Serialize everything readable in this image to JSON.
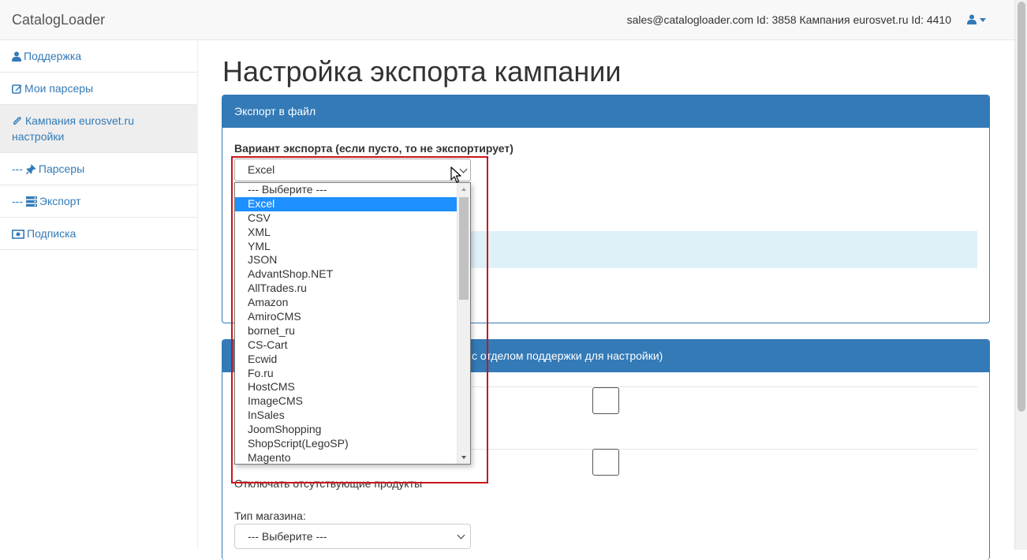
{
  "navbar": {
    "brand": "CatalogLoader",
    "info": "sales@catalogloader.com Id: 3858 Кампания eurosvet.ru Id: 4410"
  },
  "sidebar": {
    "items": [
      {
        "label": "Поддержка",
        "icon": "user-icon"
      },
      {
        "label": "Мои парсеры",
        "icon": "edit-icon"
      },
      {
        "label": "Кампания eurosvet.ru настройки",
        "icon": "paperclip-icon"
      },
      {
        "label": "Парсеры",
        "prefix": "---",
        "icon": "pushpin-icon"
      },
      {
        "label": "Экспорт",
        "prefix": "---",
        "icon": "server-icon"
      },
      {
        "label": "Подписка",
        "icon": "money-icon"
      }
    ]
  },
  "main": {
    "title": "Настройка экспорта кампании",
    "panel1": {
      "heading": "Экспорт в файл",
      "export_label": "Вариант экспорта (если пусто, то не экспортирует)",
      "export_value": "Excel"
    },
    "panel2": {
      "heading_visible": "с отделом поддержки для настройки)",
      "disable_missing_label": "Отключать отсутствующие продукты",
      "shop_type_label": "Тип магазина:",
      "shop_type_value": "--- Выберите ---"
    }
  },
  "dropdown": {
    "selected_index": 1,
    "options": [
      "--- Выберите ---",
      "Excel",
      "CSV",
      "XML",
      "YML",
      "JSON",
      "AdvantShop.NET",
      "AllTrades.ru",
      "Amazon",
      "AmiroCMS",
      "bornet_ru",
      "CS-Cart",
      "Ecwid",
      "Fo.ru",
      "HostCMS",
      "ImageCMS",
      "InSales",
      "JoomShopping",
      "ShopScript(LegoSP)",
      "Magento"
    ]
  },
  "colors": {
    "accent": "#337ab7",
    "selected_option": "#1e90ff",
    "highlight": "#c8161d"
  }
}
